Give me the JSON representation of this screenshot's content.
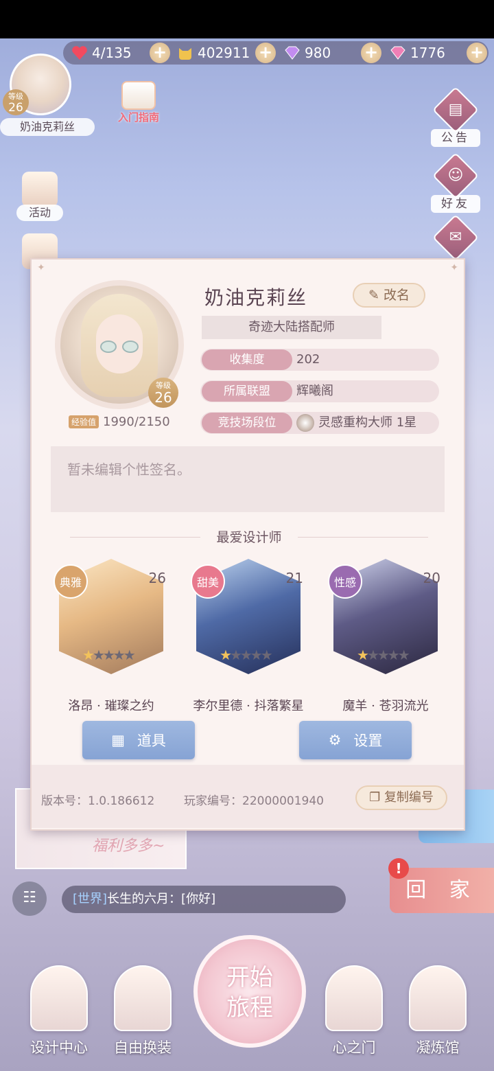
{
  "currency": {
    "stamina": "4/135",
    "gold": "402911",
    "diamond": "980",
    "crystal": "1776"
  },
  "player_badge": {
    "level_label": "等级",
    "level": "26",
    "name": "奶油克莉丝"
  },
  "guide_label": "入门指南",
  "left_buttons": {
    "activity": "活动"
  },
  "right_buttons": {
    "notice": "公告",
    "friends": "好友"
  },
  "profile": {
    "name": "奶油克莉丝",
    "rename": "改名",
    "title": "奇迹大陆搭配师",
    "level_label": "等级",
    "level": "26",
    "exp_label": "经验值",
    "exp": "1990/2150",
    "rows": [
      {
        "key": "收集度",
        "value": "202"
      },
      {
        "key": "所属联盟",
        "value": "辉曦阁"
      },
      {
        "key": "竞技场段位",
        "value": "灵感重构大师 1星"
      }
    ],
    "signature_placeholder": "暂未编辑个性签名。",
    "favorite_title": "最爱设计师",
    "designers": [
      {
        "style": "典雅",
        "level": "26",
        "stars": 1,
        "max_stars": 5,
        "name": "洛昂 · 璀璨之约",
        "style_color": "#d9a46c"
      },
      {
        "style": "甜美",
        "level": "21",
        "stars": 1,
        "max_stars": 5,
        "name": "李尔里德 · 抖落繁星",
        "style_color": "#e8798e"
      },
      {
        "style": "性感",
        "level": "20",
        "stars": 1,
        "max_stars": 5,
        "name": "魔羊 · 苍羽流光",
        "style_color": "#9a6bb0"
      }
    ],
    "items_button": "道具",
    "settings_button": "设置",
    "version": "版本号：1.0.186612",
    "player_id": "玩家编号：22000001940",
    "copy_button": "复制编号"
  },
  "promo_text": "福利多多~",
  "home_button": "回 家",
  "alert_mark": "!",
  "chat": {
    "channel": "[世界]",
    "message": "长生的六月：[你好]"
  },
  "nav": {
    "design_center": "设计中心",
    "free_dress": "自由换装",
    "start_journey_1": "开始",
    "start_journey_2": "旅程",
    "heart_gate": "心之门",
    "refinery": "凝炼馆"
  }
}
